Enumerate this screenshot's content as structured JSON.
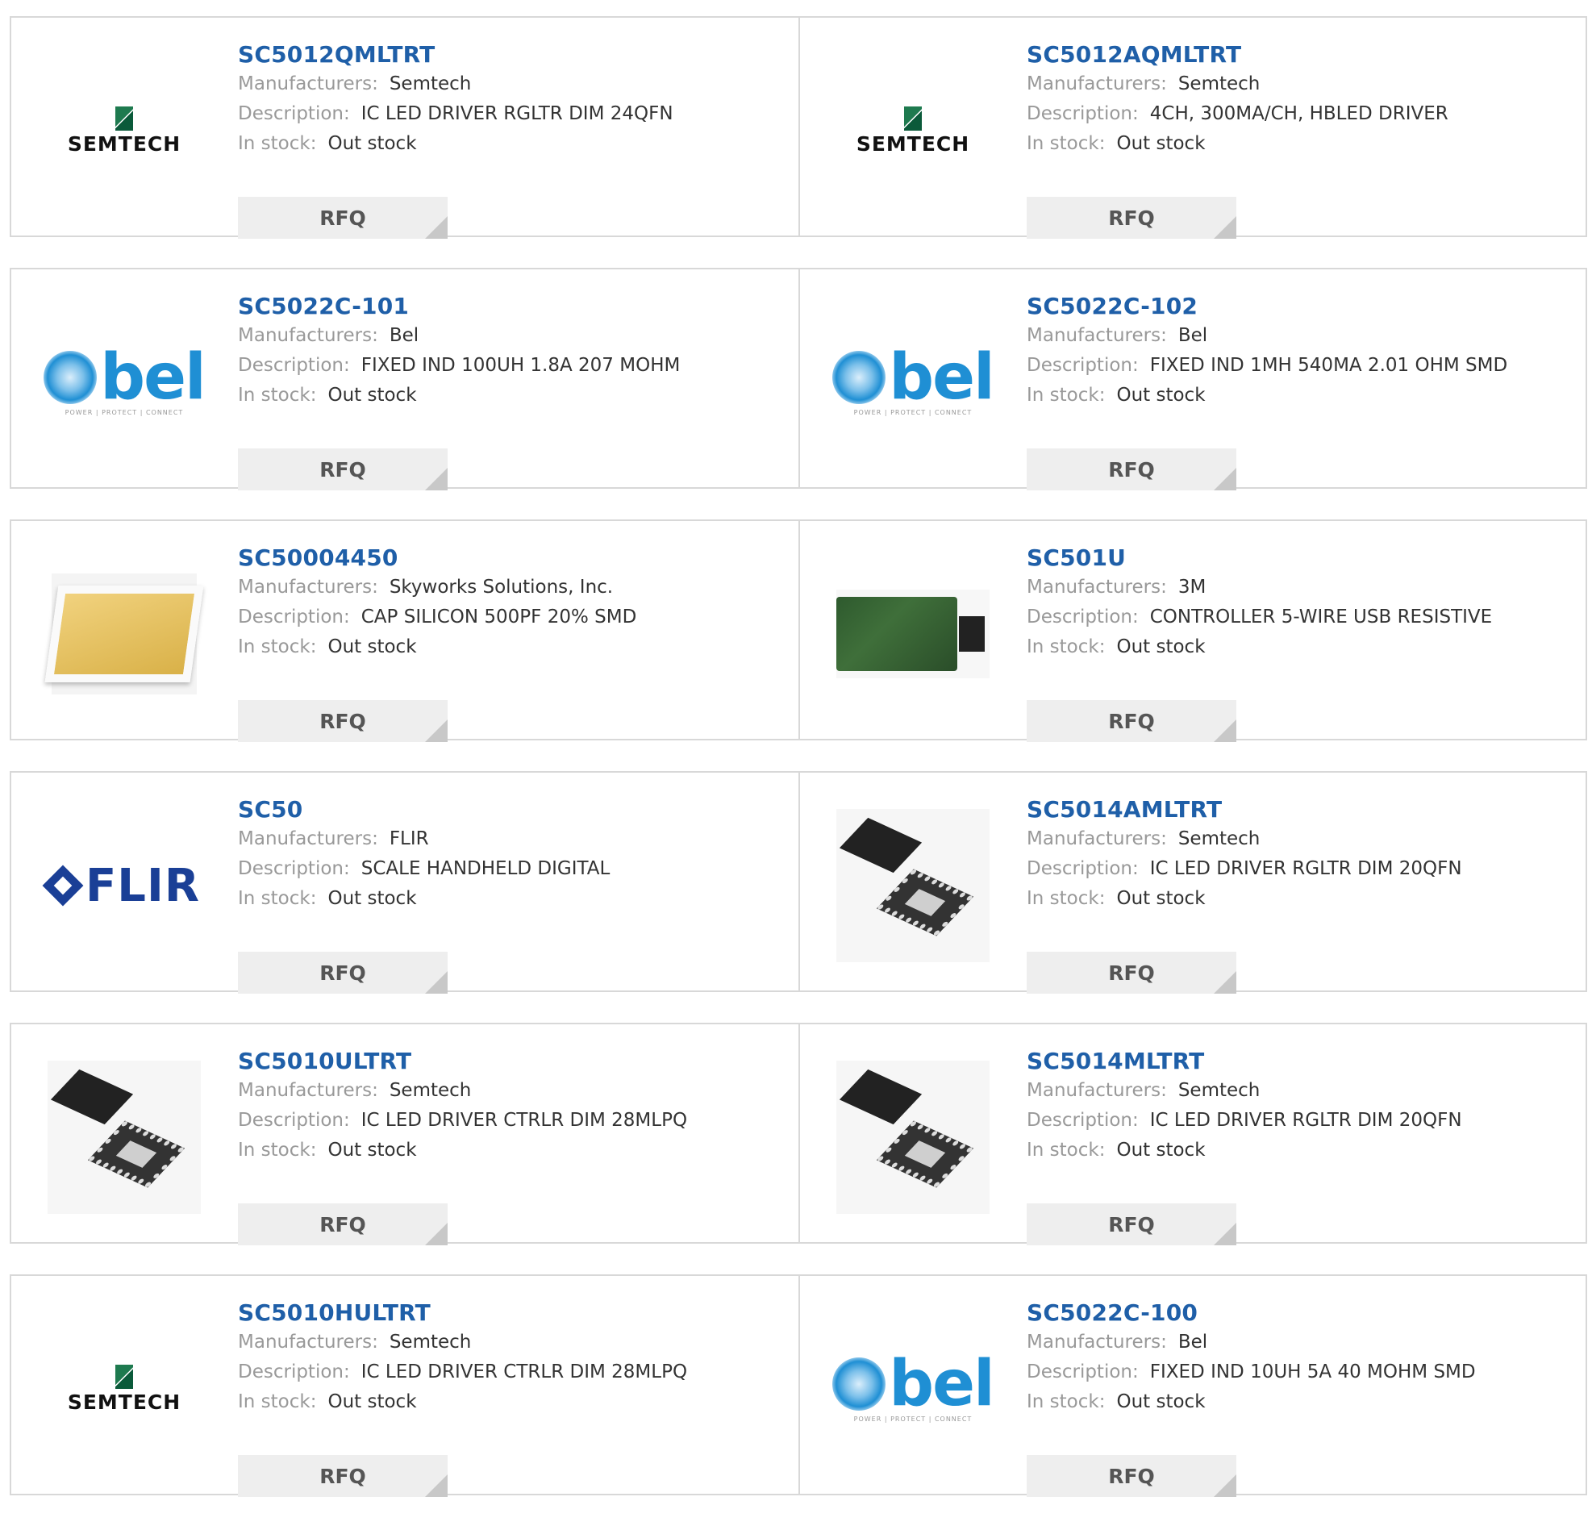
{
  "labels": {
    "manufacturers": "Manufacturers:",
    "description": "Description:",
    "in_stock": "In stock:",
    "rfq": "RFQ"
  },
  "products": [
    {
      "part": "SC5012QMLTRT",
      "manufacturer": "Semtech",
      "description": "IC LED DRIVER RGLTR DIM 24QFN",
      "stock": "Out stock",
      "logo": "semtech-logo",
      "logo_text": "SEMTECH"
    },
    {
      "part": "SC5012AQMLTRT",
      "manufacturer": "Semtech",
      "description": "4CH, 300MA/CH, HBLED DRIVER",
      "stock": "Out stock",
      "logo": "semtech-logo",
      "logo_text": "SEMTECH"
    },
    {
      "part": "SC5022C-101",
      "manufacturer": "Bel",
      "description": "FIXED IND 100UH 1.8A 207 MOHM",
      "stock": "Out stock",
      "logo": "bel-logo",
      "logo_text": "bel",
      "logo_tagline": "POWER | PROTECT | CONNECT"
    },
    {
      "part": "SC5022C-102",
      "manufacturer": "Bel",
      "description": "FIXED IND 1MH 540MA 2.01 OHM SMD",
      "stock": "Out stock",
      "logo": "bel-logo",
      "logo_text": "bel",
      "logo_tagline": "POWER | PROTECT | CONNECT"
    },
    {
      "part": "SC50004450",
      "manufacturer": "Skyworks Solutions, Inc.",
      "description": "CAP SILICON 500PF 20% SMD",
      "stock": "Out stock",
      "logo": "capacitor-image"
    },
    {
      "part": "SC501U",
      "manufacturer": "3M",
      "description": "CONTROLLER 5-WIRE USB RESISTIVE",
      "stock": "Out stock",
      "logo": "pcb-image"
    },
    {
      "part": "SC50",
      "manufacturer": "FLIR",
      "description": "SCALE HANDHELD DIGITAL",
      "stock": "Out stock",
      "logo": "flir-logo",
      "logo_text": "FLIR"
    },
    {
      "part": "SC5014AMLTRT",
      "manufacturer": "Semtech",
      "description": "IC LED DRIVER RGLTR DIM 20QFN",
      "stock": "Out stock",
      "logo": "qfn-chip-image"
    },
    {
      "part": "SC5010ULTRT",
      "manufacturer": "Semtech",
      "description": "IC LED DRIVER CTRLR DIM 28MLPQ",
      "stock": "Out stock",
      "logo": "qfn-chip-image"
    },
    {
      "part": "SC5014MLTRT",
      "manufacturer": "Semtech",
      "description": "IC LED DRIVER RGLTR DIM 20QFN",
      "stock": "Out stock",
      "logo": "qfn-chip-image"
    },
    {
      "part": "SC5010HULTRT",
      "manufacturer": "Semtech",
      "description": "IC LED DRIVER CTRLR DIM 28MLPQ",
      "stock": "Out stock",
      "logo": "semtech-logo",
      "logo_text": "SEMTECH"
    },
    {
      "part": "SC5022C-100",
      "manufacturer": "Bel",
      "description": "FIXED IND 10UH 5A 40 MOHM SMD",
      "stock": "Out stock",
      "logo": "bel-logo",
      "logo_text": "bel",
      "logo_tagline": "POWER | PROTECT | CONNECT"
    }
  ],
  "colors": {
    "part_link": "#1f5fa8",
    "label": "#999999",
    "value": "#333333",
    "rfq_bg": "#eeeeee",
    "border": "#d8d8d8"
  }
}
